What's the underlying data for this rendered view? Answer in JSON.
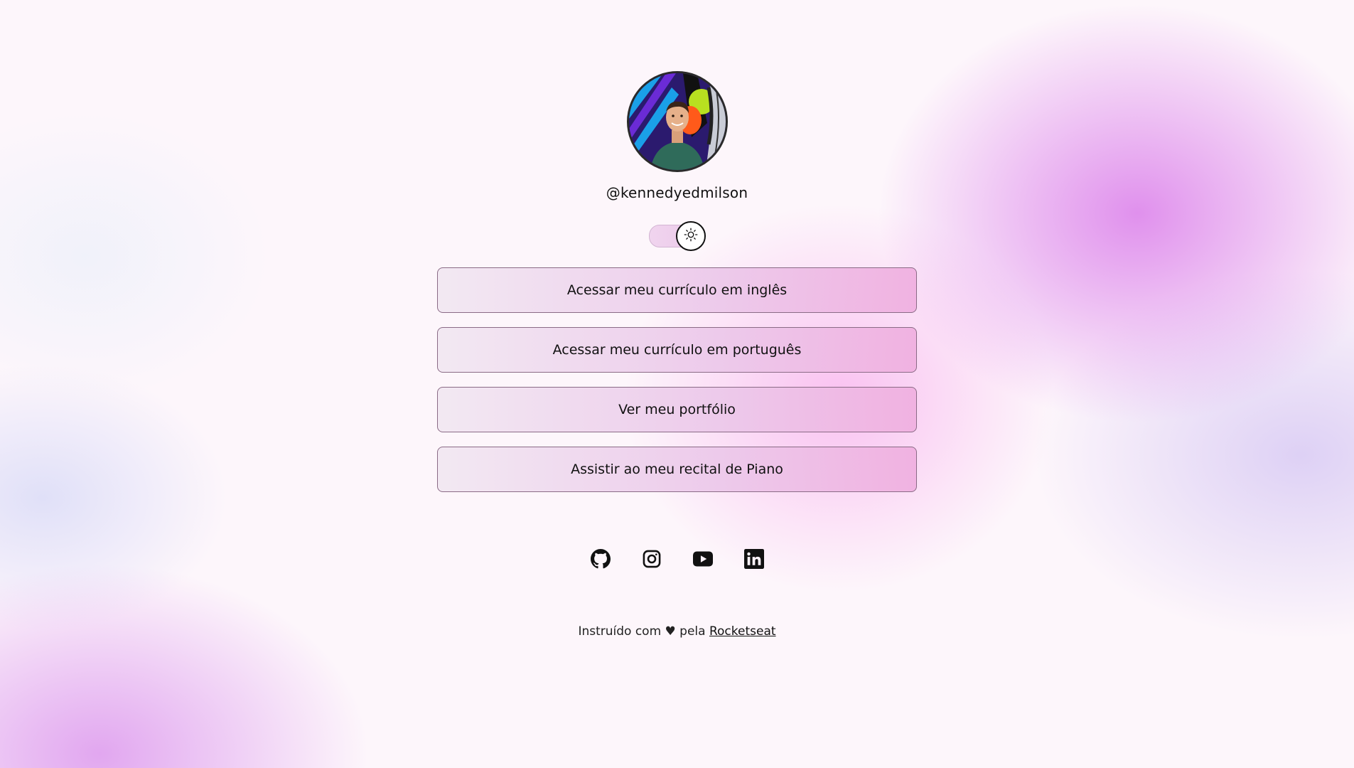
{
  "profile": {
    "username": "@kennedyedmilson"
  },
  "theme_toggle": {
    "mode": "light",
    "icon": "sun-icon"
  },
  "links": [
    {
      "label": "Acessar meu currículo em inglês"
    },
    {
      "label": "Acessar meu currículo em português"
    },
    {
      "label": "Ver meu portfólio"
    },
    {
      "label": "Assistir ao meu recital de Piano"
    }
  ],
  "social": [
    {
      "icon": "github-icon"
    },
    {
      "icon": "instagram-icon"
    },
    {
      "icon": "youtube-icon"
    },
    {
      "icon": "linkedin-icon"
    }
  ],
  "footer": {
    "text": "Instruído com ♥ pela",
    "link_label": "Rocketseat"
  },
  "colors": {
    "button_border": "#8a6b86",
    "text": "#111111",
    "accent_pink": "#f0b0e0",
    "accent_purple": "#d66ee8"
  }
}
